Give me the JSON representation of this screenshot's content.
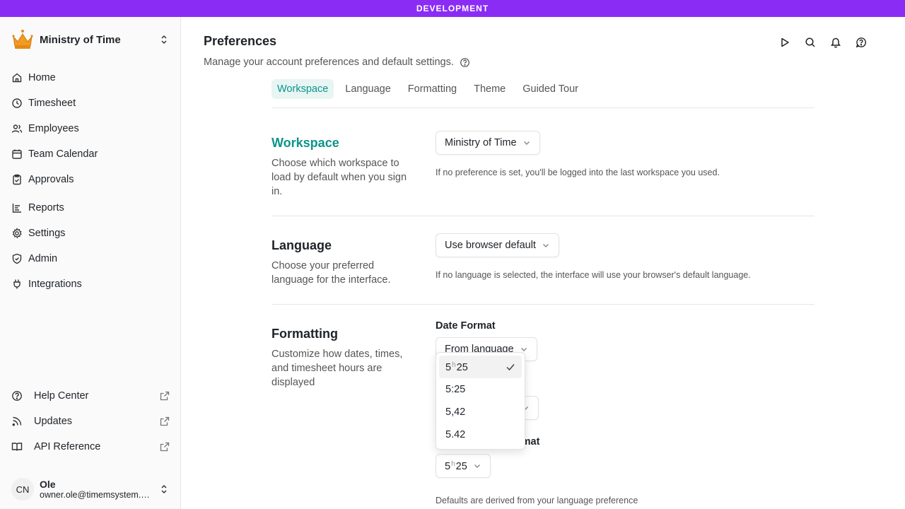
{
  "env_banner": "DEVELOPMENT",
  "sidebar": {
    "workspace": "Ministry of Time",
    "nav": [
      {
        "label": "Home",
        "icon": "home-icon"
      },
      {
        "label": "Timesheet",
        "icon": "clock-icon"
      },
      {
        "label": "Employees",
        "icon": "users-icon"
      },
      {
        "label": "Team Calendar",
        "icon": "calendar-icon"
      },
      {
        "label": "Approvals",
        "icon": "clipboard-check-icon"
      },
      {
        "label": "Reports",
        "icon": "reports-icon"
      },
      {
        "label": "Settings",
        "icon": "gear-icon"
      },
      {
        "label": "Admin",
        "icon": "shield-icon"
      },
      {
        "label": "Integrations",
        "icon": "plug-icon"
      }
    ],
    "footer": [
      {
        "label": "Help Center",
        "icon": "help-circle-icon"
      },
      {
        "label": "Updates",
        "icon": "rss-icon"
      },
      {
        "label": "API Reference",
        "icon": "book-icon"
      }
    ],
    "user": {
      "initials": "CN",
      "name": "Ole",
      "email": "owner.ole@timemsystem.com"
    }
  },
  "page": {
    "title": "Preferences",
    "subtitle": "Manage your account preferences and default settings.",
    "tabs": [
      "Workspace",
      "Language",
      "Formatting",
      "Theme",
      "Guided Tour"
    ],
    "active_tab": "Workspace"
  },
  "sections": {
    "workspace": {
      "title": "Workspace",
      "desc": "Choose which workspace to load by default when you sign in.",
      "value": "Ministry of Time",
      "hint": "If no preference is set, you'll be logged into the last workspace you used."
    },
    "language": {
      "title": "Language",
      "desc": "Choose your preferred language for the interface.",
      "value": "Use browser default",
      "hint": "If no language is selected, the interface will use your browser's default language."
    },
    "formatting": {
      "title": "Formatting",
      "desc": "Customize how dates, times, and timesheet hours are displayed",
      "date_label": "Date Format",
      "date_value": "From language",
      "hours_label_tail": "rmat",
      "hours_value": {
        "h": "5",
        "sep": "h",
        "m": "25"
      },
      "hint": "Defaults are derived from your language preference"
    }
  },
  "dropdown": {
    "options": [
      {
        "a": "5",
        "sep": "h",
        "b": "25",
        "selected": true
      },
      {
        "label": "5:25"
      },
      {
        "label": "5,42"
      },
      {
        "label": "5.42"
      }
    ]
  },
  "colors": {
    "banner": "#8b2cf5",
    "accent": "#0d9488"
  }
}
